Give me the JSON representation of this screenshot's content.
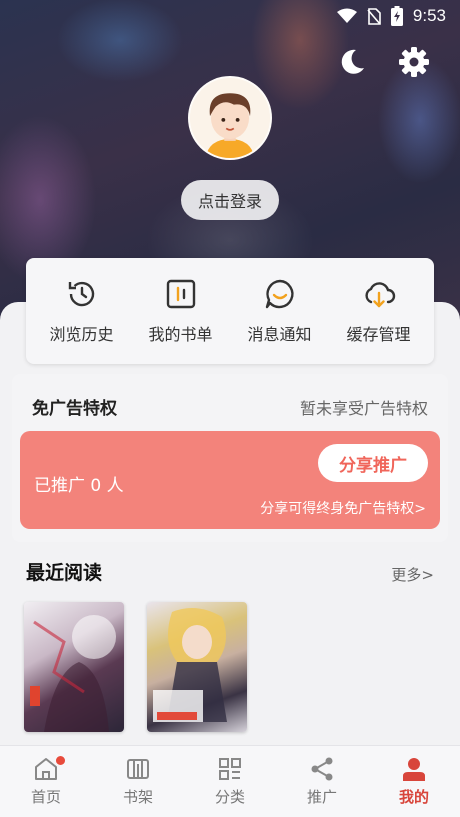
{
  "status_bar": {
    "time": "9:53"
  },
  "profile": {
    "login_label": "点击登录"
  },
  "quick_actions": [
    {
      "label": "浏览历史",
      "icon": "history-icon"
    },
    {
      "label": "我的书单",
      "icon": "booklist-icon"
    },
    {
      "label": "消息通知",
      "icon": "message-icon"
    },
    {
      "label": "缓存管理",
      "icon": "cloud-download-icon"
    }
  ],
  "ad_free": {
    "title": "免广告特权",
    "status": "暂未享受广告特权",
    "promoted_count": "已推广 0 人",
    "share_button": "分享推广",
    "share_hint": "分享可得终身免广告特权>"
  },
  "recent": {
    "title": "最近阅读",
    "more_label": "更多>"
  },
  "tabs": [
    {
      "label": "首页",
      "icon": "home-icon",
      "badge": true
    },
    {
      "label": "书架",
      "icon": "bookshelf-icon"
    },
    {
      "label": "分类",
      "icon": "category-icon"
    },
    {
      "label": "推广",
      "icon": "share-icon"
    },
    {
      "label": "我的",
      "icon": "profile-icon",
      "active": true
    }
  ],
  "colors": {
    "accent": "#d8453b",
    "promo_bg": "#f3837b",
    "share_text": "#f0665b"
  }
}
